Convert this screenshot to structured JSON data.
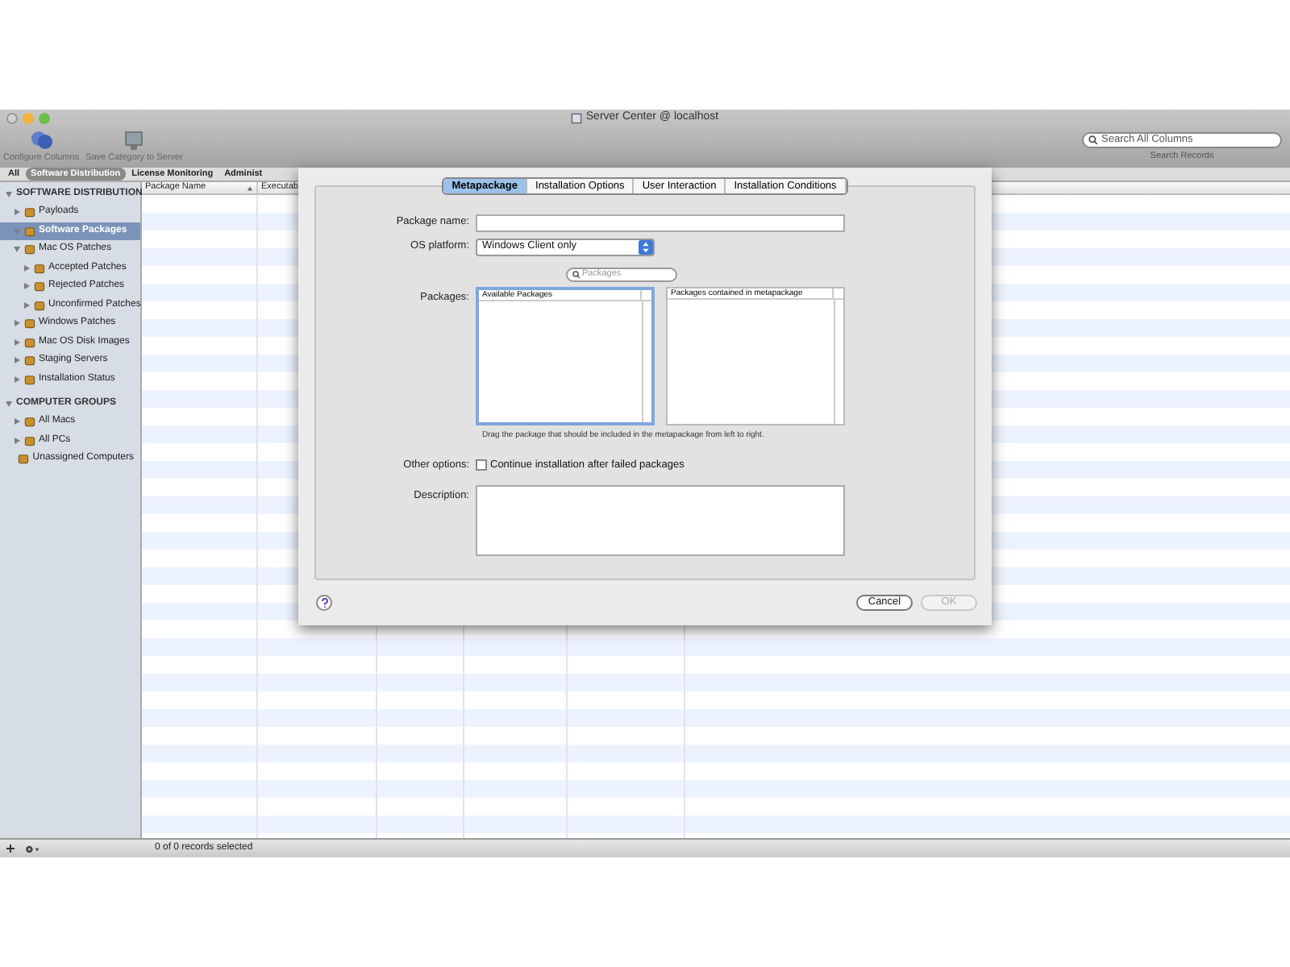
{
  "window": {
    "title": "Server Center @ localhost"
  },
  "toolbar": {
    "buttons": [
      {
        "label": "Configure Columns"
      },
      {
        "label": "Save Category to Server"
      }
    ]
  },
  "search": {
    "placeholder": "Search All Columns",
    "label": "Search Records"
  },
  "scope_tabs": [
    {
      "label": "All",
      "selected": false
    },
    {
      "label": "Software Distribution",
      "selected": true
    },
    {
      "label": "License Monitoring",
      "selected": false
    },
    {
      "label": "Administ",
      "selected": false
    }
  ],
  "sidebar": {
    "groups": [
      {
        "title": "SOFTWARE DISTRIBUTION",
        "expanded": true,
        "items": [
          {
            "label": "Payloads",
            "selected": false,
            "leaf": false,
            "expanded": false
          },
          {
            "label": "Software Packages",
            "selected": true,
            "leaf": false,
            "expanded": true
          },
          {
            "label": "Mac OS Patches",
            "selected": false,
            "leaf": false,
            "expanded": true,
            "children": [
              {
                "label": "Accepted Patches",
                "selected": false,
                "leaf": false,
                "expanded": false
              },
              {
                "label": "Rejected Patches",
                "selected": false,
                "leaf": false,
                "expanded": false
              },
              {
                "label": "Unconfirmed Patches",
                "selected": false,
                "leaf": false,
                "expanded": false
              }
            ]
          },
          {
            "label": "Windows Patches",
            "selected": false,
            "leaf": false,
            "expanded": false
          },
          {
            "label": "Mac OS Disk Images",
            "selected": false,
            "leaf": false,
            "expanded": false
          },
          {
            "label": "Staging Servers",
            "selected": false,
            "leaf": false,
            "expanded": false
          },
          {
            "label": "Installation Status",
            "selected": false,
            "leaf": false,
            "expanded": false
          }
        ]
      },
      {
        "title": "COMPUTER GROUPS",
        "expanded": true,
        "items": [
          {
            "label": "All Macs",
            "selected": false,
            "leaf": false,
            "expanded": false
          },
          {
            "label": "All PCs",
            "selected": false,
            "leaf": false,
            "expanded": false
          },
          {
            "label": "Unassigned Computers",
            "selected": false,
            "leaf": true,
            "expanded": false
          }
        ]
      }
    ]
  },
  "table": {
    "columns": [
      "Package Name",
      "Executab"
    ]
  },
  "status_bar": "0 of 0 records selected",
  "sheet": {
    "tabs": [
      {
        "label": "Metapackage",
        "selected": true
      },
      {
        "label": "Installation Options",
        "selected": false
      },
      {
        "label": "User Interaction",
        "selected": false
      },
      {
        "label": "Installation Conditions",
        "selected": false
      }
    ],
    "package_name": {
      "label": "Package name:"
    },
    "os_platform": {
      "label": "OS platform:",
      "value": "Windows Client only"
    },
    "packages_search": {
      "placeholder": "Packages"
    },
    "packages": {
      "label": "Packages:",
      "available_header": "Available Packages",
      "contained_header": "Packages contained in metapackage",
      "hint": "Drag the package that should be included in the metapackage from left to right."
    },
    "other_options": {
      "label": "Other options:",
      "checkbox": {
        "label": "Continue installation after failed packages",
        "checked": false
      }
    },
    "description": {
      "label": "Description:"
    },
    "buttons": [
      {
        "label": "Cancel",
        "disabled": false
      },
      {
        "label": "OK",
        "disabled": true
      }
    ]
  }
}
